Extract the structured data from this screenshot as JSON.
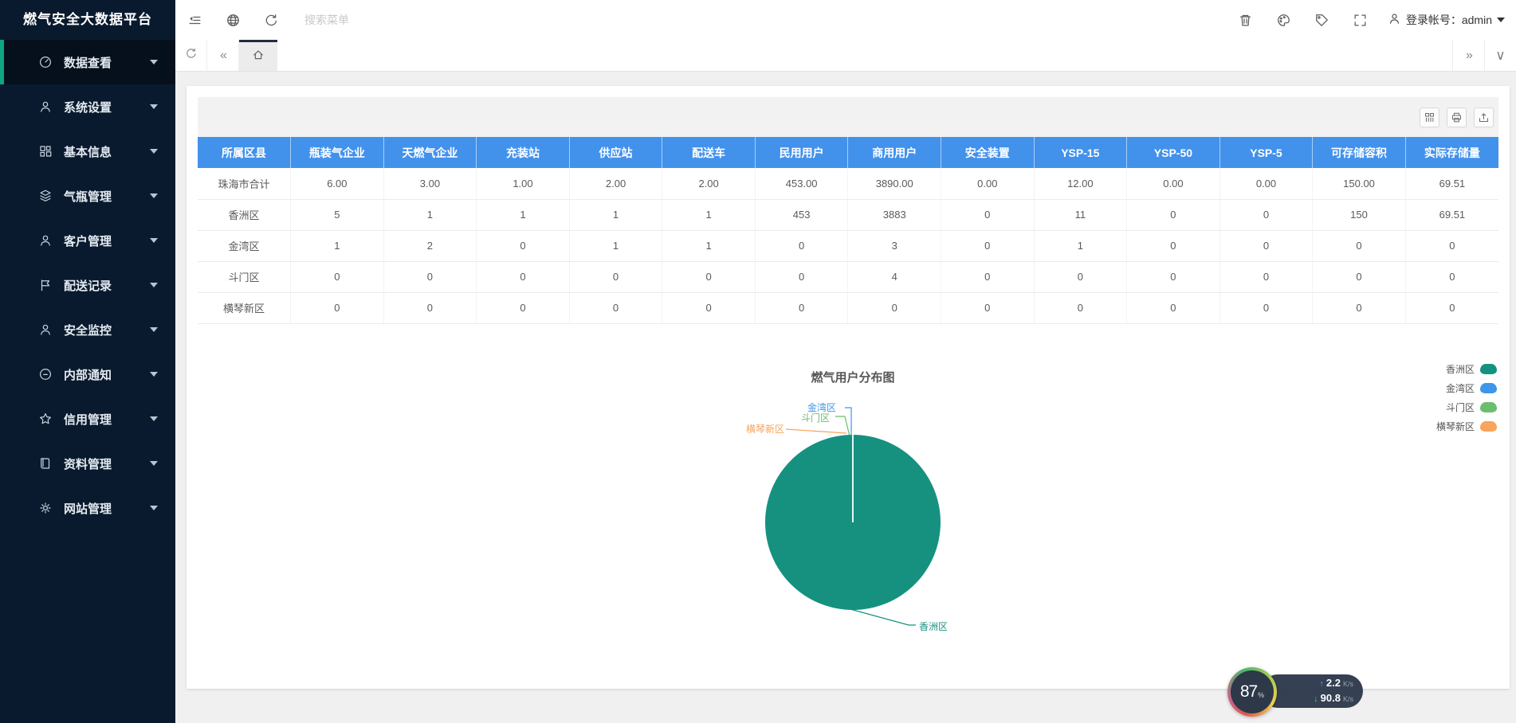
{
  "app": {
    "title": "燃气安全大数据平台"
  },
  "topbar": {
    "search_placeholder": "搜索菜单",
    "account_label": "登录帐号：admin",
    "tools_left": [
      {
        "name": "menu-fold-icon",
        "icon": "fold"
      },
      {
        "name": "globe-icon",
        "icon": "globe"
      },
      {
        "name": "refresh-icon",
        "icon": "refresh"
      }
    ],
    "tools_right": [
      {
        "name": "trash-icon",
        "icon": "trash"
      },
      {
        "name": "theme-palette-icon",
        "icon": "palette"
      },
      {
        "name": "tag-icon",
        "icon": "tag"
      },
      {
        "name": "fullscreen-icon",
        "icon": "expand"
      }
    ]
  },
  "tabbar": {
    "left_chevrons": "«",
    "right_chevrons": "»",
    "caret": "∨"
  },
  "sidebar": {
    "items": [
      {
        "label": "数据查看",
        "icon": "gauge",
        "active": true
      },
      {
        "label": "系统设置",
        "icon": "user",
        "active": false
      },
      {
        "label": "基本信息",
        "icon": "grid",
        "active": false
      },
      {
        "label": "气瓶管理",
        "icon": "layers",
        "active": false
      },
      {
        "label": "客户管理",
        "icon": "user",
        "active": false
      },
      {
        "label": "配送记录",
        "icon": "flag",
        "active": false
      },
      {
        "label": "安全监控",
        "icon": "user",
        "active": false
      },
      {
        "label": "内部通知",
        "icon": "chat",
        "active": false
      },
      {
        "label": "信用管理",
        "icon": "star",
        "active": false
      },
      {
        "label": "资料管理",
        "icon": "book",
        "active": false
      },
      {
        "label": "网站管理",
        "icon": "gear",
        "active": false
      }
    ]
  },
  "panel": {
    "buttons": [
      {
        "name": "columns-button",
        "icon": "columns"
      },
      {
        "name": "print-button",
        "icon": "printer"
      },
      {
        "name": "export-button",
        "icon": "export"
      }
    ]
  },
  "table": {
    "headers": [
      "所属区县",
      "瓶装气企业",
      "天燃气企业",
      "充装站",
      "供应站",
      "配送车",
      "民用用户",
      "商用用户",
      "安全装置",
      "YSP-15",
      "YSP-50",
      "YSP-5",
      "可存储容积",
      "实际存储量"
    ],
    "rows": [
      [
        "珠海市合计",
        "6.00",
        "3.00",
        "1.00",
        "2.00",
        "2.00",
        "453.00",
        "3890.00",
        "0.00",
        "12.00",
        "0.00",
        "0.00",
        "150.00",
        "69.51"
      ],
      [
        "香洲区",
        "5",
        "1",
        "1",
        "1",
        "1",
        "453",
        "3883",
        "0",
        "11",
        "0",
        "0",
        "150",
        "69.51"
      ],
      [
        "金湾区",
        "1",
        "2",
        "0",
        "1",
        "1",
        "0",
        "3",
        "0",
        "1",
        "0",
        "0",
        "0",
        "0"
      ],
      [
        "斗门区",
        "0",
        "0",
        "0",
        "0",
        "0",
        "0",
        "4",
        "0",
        "0",
        "0",
        "0",
        "0",
        "0"
      ],
      [
        "横琴新区",
        "0",
        "0",
        "0",
        "0",
        "0",
        "0",
        "0",
        "0",
        "0",
        "0",
        "0",
        "0",
        "0"
      ]
    ]
  },
  "chart_data": {
    "type": "pie",
    "title": "燃气用户分布图",
    "labels": [
      "香洲区",
      "金湾区",
      "斗门区",
      "横琴新区"
    ],
    "values": [
      99.8,
      0.08,
      0.1,
      0.02
    ],
    "unit": "percent_estimated_share",
    "colors": [
      "#169180",
      "#3E95E9",
      "#6CBE6F",
      "#F8A45C"
    ],
    "legend_position": "right"
  },
  "widget": {
    "percent": "87",
    "percent_unit": "%",
    "up_value": "2.2",
    "down_value": "90.8",
    "speed_unit": "K/s",
    "up_arrow": "↑",
    "down_arrow": "↓"
  }
}
